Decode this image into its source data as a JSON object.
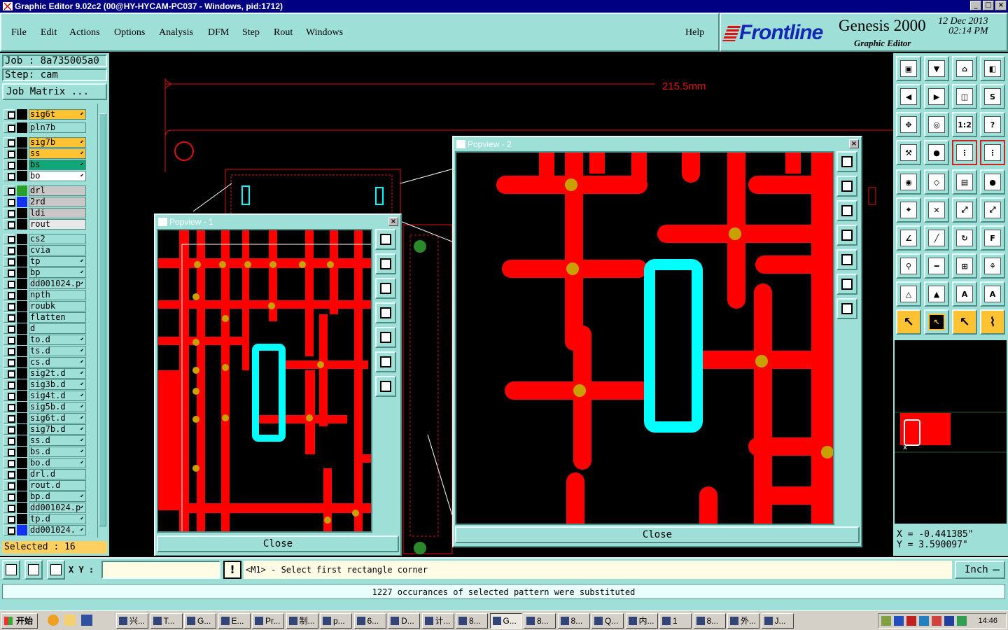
{
  "window": {
    "title": "Graphic Editor 9.02c2 (00@HY-HYCAM-PC037 - Windows, pid:1712)"
  },
  "menu": {
    "items": [
      "File",
      "Edit",
      "Actions",
      "Options",
      "Analysis",
      "DFM",
      "Step",
      "Rout",
      "Windows"
    ],
    "help": "Help"
  },
  "brand": {
    "logo": "Frontline",
    "product": "Genesis 2000",
    "subtitle": "Graphic Editor",
    "date": "12 Dec 2013",
    "time": "02:14 PM"
  },
  "job": {
    "job_label": "Job : 8a735005a0",
    "step_label": "Step: cam",
    "matrix_button": "Job Matrix ..."
  },
  "layers": [
    {
      "name": "sig6t",
      "color": "#ffc232",
      "swatch": "#000000",
      "arrow": true
    },
    {
      "name": "pln7b",
      "color": "#9edfd8",
      "swatch": "#000000",
      "arrow": false
    },
    {
      "name": "sig7b",
      "color": "#ffc232",
      "swatch": "#000000",
      "arrow": true
    },
    {
      "name": "ss",
      "color": "#ffc232",
      "swatch": "#000000",
      "arrow": true
    },
    {
      "name": "bs",
      "color": "#10a878",
      "swatch": "#000000",
      "arrow": true
    },
    {
      "name": "bo",
      "color": "#ffffff",
      "swatch": "#000000",
      "arrow": true
    },
    {
      "name": "drl",
      "color": "#c8c8c8",
      "swatch": "#2aa02a",
      "arrow": false
    },
    {
      "name": "2rd",
      "color": "#c8c8c8",
      "swatch": "#1430f0",
      "arrow": false
    },
    {
      "name": "ldi",
      "color": "#c8c8c8",
      "swatch": "#000000",
      "arrow": false
    },
    {
      "name": "rout",
      "color": "#e8e8e8",
      "swatch": "#000000",
      "arrow": false
    },
    {
      "name": "cs2",
      "color": "#9edfd8",
      "swatch": "#000000",
      "arrow": false
    },
    {
      "name": "cvia",
      "color": "#9edfd8",
      "swatch": "#000000",
      "arrow": false
    },
    {
      "name": "tp",
      "color": "#9edfd8",
      "swatch": "#000000",
      "arrow": true
    },
    {
      "name": "bp",
      "color": "#9edfd8",
      "swatch": "#000000",
      "arrow": true
    },
    {
      "name": "dd001024.p",
      "color": "#9edfd8",
      "swatch": "#000000",
      "arrow": true
    },
    {
      "name": "npth",
      "color": "#9edfd8",
      "swatch": "#000000",
      "arrow": false
    },
    {
      "name": "roubk",
      "color": "#9edfd8",
      "swatch": "#000000",
      "arrow": false
    },
    {
      "name": "flatten",
      "color": "#9edfd8",
      "swatch": "#000000",
      "arrow": false
    },
    {
      "name": "d",
      "color": "#9edfd8",
      "swatch": "#000000",
      "arrow": false
    },
    {
      "name": "to.d",
      "color": "#9edfd8",
      "swatch": "#000000",
      "arrow": true
    },
    {
      "name": "ts.d",
      "color": "#9edfd8",
      "swatch": "#000000",
      "arrow": true
    },
    {
      "name": "cs.d",
      "color": "#9edfd8",
      "swatch": "#000000",
      "arrow": true
    },
    {
      "name": "sig2t.d",
      "color": "#9edfd8",
      "swatch": "#000000",
      "arrow": true
    },
    {
      "name": "sig3b.d",
      "color": "#9edfd8",
      "swatch": "#000000",
      "arrow": true
    },
    {
      "name": "sig4t.d",
      "color": "#9edfd8",
      "swatch": "#000000",
      "arrow": true
    },
    {
      "name": "sig5b.d",
      "color": "#9edfd8",
      "swatch": "#000000",
      "arrow": true
    },
    {
      "name": "sig6t.d",
      "color": "#9edfd8",
      "swatch": "#000000",
      "arrow": true
    },
    {
      "name": "sig7b.d",
      "color": "#9edfd8",
      "swatch": "#000000",
      "arrow": true
    },
    {
      "name": "ss.d",
      "color": "#9edfd8",
      "swatch": "#000000",
      "arrow": true
    },
    {
      "name": "bs.d",
      "color": "#9edfd8",
      "swatch": "#000000",
      "arrow": true
    },
    {
      "name": "bo.d",
      "color": "#9edfd8",
      "swatch": "#000000",
      "arrow": true
    },
    {
      "name": "drl.d",
      "color": "#9edfd8",
      "swatch": "#000000",
      "arrow": false
    },
    {
      "name": "rout.d",
      "color": "#9edfd8",
      "swatch": "#000000",
      "arrow": false
    },
    {
      "name": "bp.d",
      "color": "#9edfd8",
      "swatch": "#000000",
      "arrow": true
    },
    {
      "name": "dd001024.p",
      "color": "#9edfd8",
      "swatch": "#000000",
      "arrow": true
    },
    {
      "name": "tp.d",
      "color": "#9edfd8",
      "swatch": "#000000",
      "arrow": true
    },
    {
      "name": "dd001024.",
      "color": "#9edfd8",
      "swatch": "#1430f0",
      "arrow": true
    }
  ],
  "selected_label": "Selected : 16",
  "canvas": {
    "dimension_label": "215.5mm"
  },
  "popview1": {
    "title": "Popview - 1",
    "close_label": "Close"
  },
  "popview2": {
    "title": "Popview - 2",
    "close_label": "Close"
  },
  "coords": {
    "x_label": "X = -0.441385\"",
    "y_label": "Y = 3.590097\""
  },
  "bottombar": {
    "xy_label": "X Y :",
    "xy_value": "",
    "prompt": "<M1> - Select first rectangle corner",
    "unit": "Inch"
  },
  "message": "1227 occurances of selected pattern were substituted",
  "taskbar": {
    "start_label": "开始",
    "tasks": [
      "兴...",
      "T...",
      "G...",
      "E...",
      "Pr...",
      "制...",
      "p...",
      "6...",
      "D...",
      "计...",
      "8...",
      "G...",
      "8...",
      "8...",
      "Q...",
      "内...",
      "1",
      "8...",
      "外...",
      "J..."
    ],
    "active_index": 11,
    "clock": "14:46"
  },
  "colors": {
    "teal": "#9edfd8",
    "copper": "#ff0000",
    "selection": "#00ffff",
    "pad": "#c8a000"
  }
}
